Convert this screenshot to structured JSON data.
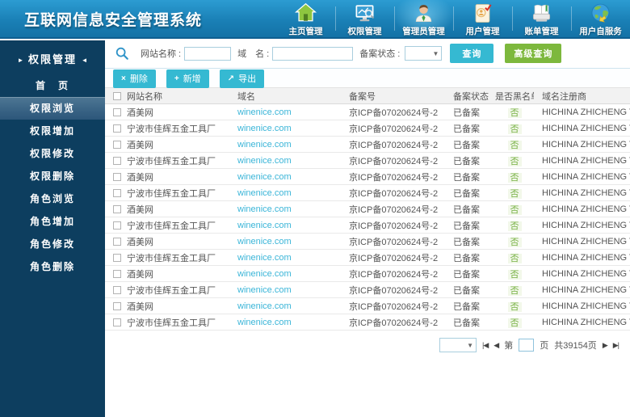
{
  "app_title": "互联网信息安全管理系统",
  "top_nav": {
    "items": [
      {
        "label": "主页管理",
        "icon": "home-icon",
        "active": false
      },
      {
        "label": "权限管理",
        "icon": "monitor-chart-icon",
        "active": false
      },
      {
        "label": "管理员管理",
        "icon": "admin-person-icon",
        "active": true
      },
      {
        "label": "用户管理",
        "icon": "user-card-icon",
        "active": false
      },
      {
        "label": "账单管理",
        "icon": "billing-book-icon",
        "active": false
      },
      {
        "label": "用户自服务",
        "icon": "globe-icon",
        "active": false
      }
    ]
  },
  "sidebar": {
    "header": "权限管理",
    "arrow_left": "►",
    "arrow_right": "◄",
    "items": [
      {
        "label": "首　页",
        "active": false
      },
      {
        "label": "权限浏览",
        "active": true
      },
      {
        "label": "权限增加",
        "active": false
      },
      {
        "label": "权限修改",
        "active": false
      },
      {
        "label": "权限删除",
        "active": false
      },
      {
        "label": "角色浏览",
        "active": false
      },
      {
        "label": "角色增加",
        "active": false
      },
      {
        "label": "角色修改",
        "active": false
      },
      {
        "label": "角色删除",
        "active": false
      }
    ]
  },
  "filter": {
    "site_name_label": "网站名称 :",
    "site_name_value": "",
    "domain_label": "域　名 :",
    "domain_value": "",
    "status_label": "备案状态 :",
    "status_value": "",
    "select_arrow": "▼",
    "query_button": "查询",
    "advanced_query_button": "高级查询"
  },
  "toolbar": {
    "delete_button": "删除",
    "delete_glyph": "×",
    "add_button": "新增",
    "add_glyph": "+",
    "export_button": "导出",
    "export_glyph": "↗"
  },
  "table": {
    "columns": [
      "网站名称",
      "域名",
      "备案号",
      "备案状态",
      "是否黑名单",
      "域名注册商"
    ],
    "rows": [
      {
        "site": "酒美网",
        "domain": "winenice.com",
        "filing_no": "京ICP备07020624号-2",
        "status": "已备案",
        "blacklisted": "否",
        "registrar": "HICHINA ZHICHENG TECHNOLOGY"
      },
      {
        "site": "宁波市佳辉五金工具厂",
        "domain": "winenice.com",
        "filing_no": "京ICP备07020624号-2",
        "status": "已备案",
        "blacklisted": "否",
        "registrar": "HICHINA ZHICHENG TECHNOLOGY"
      },
      {
        "site": "酒美网",
        "domain": "winenice.com",
        "filing_no": "京ICP备07020624号-2",
        "status": "已备案",
        "blacklisted": "否",
        "registrar": "HICHINA ZHICHENG TECHNOLOGY"
      },
      {
        "site": "宁波市佳辉五金工具厂",
        "domain": "winenice.com",
        "filing_no": "京ICP备07020624号-2",
        "status": "已备案",
        "blacklisted": "否",
        "registrar": "HICHINA ZHICHENG TECHNOLOGY"
      },
      {
        "site": "酒美网",
        "domain": "winenice.com",
        "filing_no": "京ICP备07020624号-2",
        "status": "已备案",
        "blacklisted": "否",
        "registrar": "HICHINA ZHICHENG TECHNOLOGY"
      },
      {
        "site": "宁波市佳辉五金工具厂",
        "domain": "winenice.com",
        "filing_no": "京ICP备07020624号-2",
        "status": "已备案",
        "blacklisted": "否",
        "registrar": "HICHINA ZHICHENG TECHNOLOGY"
      },
      {
        "site": "酒美网",
        "domain": "winenice.com",
        "filing_no": "京ICP备07020624号-2",
        "status": "已备案",
        "blacklisted": "否",
        "registrar": "HICHINA ZHICHENG TECHNOLOGY"
      },
      {
        "site": "宁波市佳辉五金工具厂",
        "domain": "winenice.com",
        "filing_no": "京ICP备07020624号-2",
        "status": "已备案",
        "blacklisted": "否",
        "registrar": "HICHINA ZHICHENG TECHNOLOGY"
      },
      {
        "site": "酒美网",
        "domain": "winenice.com",
        "filing_no": "京ICP备07020624号-2",
        "status": "已备案",
        "blacklisted": "否",
        "registrar": "HICHINA ZHICHENG TECHNOLOGY"
      },
      {
        "site": "宁波市佳辉五金工具厂",
        "domain": "winenice.com",
        "filing_no": "京ICP备07020624号-2",
        "status": "已备案",
        "blacklisted": "否",
        "registrar": "HICHINA ZHICHENG TECHNOLOGY"
      },
      {
        "site": "酒美网",
        "domain": "winenice.com",
        "filing_no": "京ICP备07020624号-2",
        "status": "已备案",
        "blacklisted": "否",
        "registrar": "HICHINA ZHICHENG TECHNOLOGY"
      },
      {
        "site": "宁波市佳辉五金工具厂",
        "domain": "winenice.com",
        "filing_no": "京ICP备07020624号-2",
        "status": "已备案",
        "blacklisted": "否",
        "registrar": "HICHINA ZHICHENG TECHNOLOGY"
      },
      {
        "site": "酒美网",
        "domain": "winenice.com",
        "filing_no": "京ICP备07020624号-2",
        "status": "已备案",
        "blacklisted": "否",
        "registrar": "HICHINA ZHICHENG TECHNOLOGY"
      },
      {
        "site": "宁波市佳辉五金工具厂",
        "domain": "winenice.com",
        "filing_no": "京ICP备07020624号-2",
        "status": "已备案",
        "blacklisted": "否",
        "registrar": "HICHINA ZHICHENG TECHNOLOGY"
      }
    ]
  },
  "pagination": {
    "select_arrow": "▼",
    "first": "|◀",
    "prev": "◀",
    "page_prefix": "第",
    "page_value": "",
    "page_suffix": "页",
    "total_pages": "共39154页",
    "next": "▶",
    "last": "▶|"
  },
  "colors": {
    "header_blue": "#1a80b6",
    "sidebar_navy": "#0d3e5f",
    "accent_cyan": "#35b9d2",
    "accent_green": "#7db83d",
    "link_cyan": "#3ab5d8",
    "flag_green": "#76b043"
  }
}
